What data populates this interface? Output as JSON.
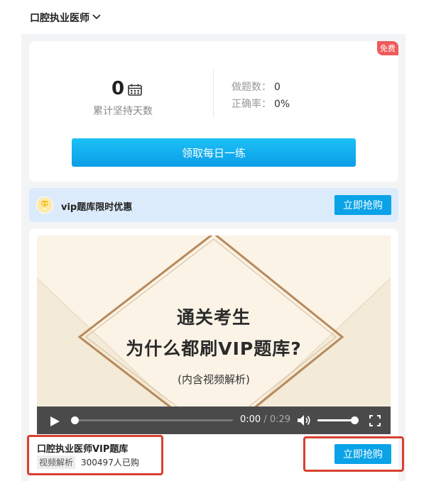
{
  "header": {
    "title": "口腔执业医师"
  },
  "stats": {
    "free_badge": "免费",
    "days": "0",
    "days_label": "累计坚持天数",
    "questions_label": "做题数：",
    "questions_value": "0",
    "accuracy_label": "正确率：",
    "accuracy_value": "0%",
    "daily_button": "领取每日一练"
  },
  "promo": {
    "text": "vip题库限时优惠",
    "button": "立即抢购"
  },
  "video": {
    "line1": "通关考生",
    "line2": "为什么都刷VIP题库?",
    "line3": "(内含视频解析)",
    "current_time": "0:00",
    "separator": " / ",
    "duration": "0:29",
    "progress_fraction": 0.0,
    "volume_fraction": 1.0
  },
  "product": {
    "title": "口腔执业医师VIP题库",
    "tag": "视频解析",
    "buyers": "300497人已购",
    "button": "立即抢购"
  },
  "colors": {
    "accent": "#0aa3e8",
    "badge": "#f05a5a",
    "highlight": "#d9402f",
    "video_bg": "#faf3e6",
    "diamond": "#b8895a"
  }
}
